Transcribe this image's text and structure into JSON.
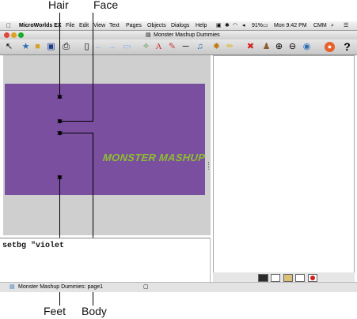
{
  "callouts": {
    "hair": "Hair",
    "face": "Face",
    "feet": "Feet",
    "body": "Body"
  },
  "menubar": {
    "app_name": "MicroWorlds EX",
    "items": [
      "File",
      "Edit",
      "View",
      "Text",
      "Pages",
      "Objects",
      "Dialogs",
      "Help"
    ],
    "status": {
      "battery": "91%",
      "clock": "Mon 9:42 PM",
      "user": "CMM"
    }
  },
  "window": {
    "title": "Monster Mashup Dummies"
  },
  "page": {
    "background_color": "#7b4fa0",
    "title_text": "MONSTER MASHUP",
    "title_color": "#8cbf2e"
  },
  "command_center": {
    "text": "setbg \"violet"
  },
  "statusbar": {
    "text": "Monster Mashup Dummies: page1"
  },
  "colors": {
    "accent_red": "#d3201e",
    "stop_orange": "#e8602c"
  }
}
